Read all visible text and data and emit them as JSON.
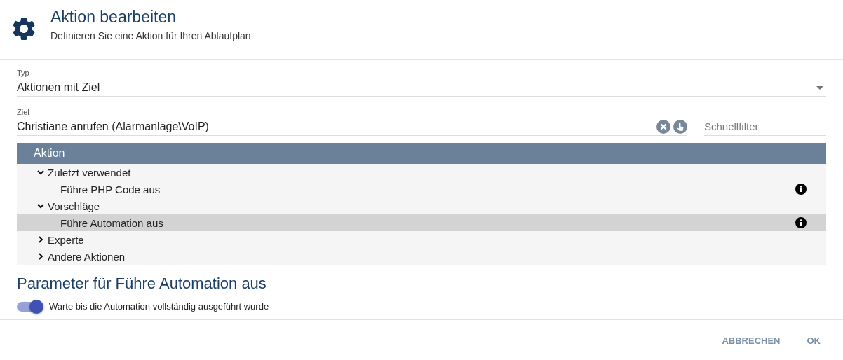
{
  "header": {
    "title": "Aktion bearbeiten",
    "subtitle": "Definieren Sie eine Aktion für Ihren Ablaufplan"
  },
  "type_field": {
    "label": "Typ",
    "value": "Aktionen mit Ziel"
  },
  "target_field": {
    "label": "Ziel",
    "value": "Christiane anrufen (Alarmanlage\\VoIP)"
  },
  "quick_filter": {
    "placeholder": "Schnellfilter"
  },
  "table": {
    "column": "Aktion",
    "tree": [
      {
        "label": "Zuletzt verwendet",
        "expanded": true,
        "children": [
          {
            "label": "Führe PHP Code aus",
            "selected": false
          }
        ]
      },
      {
        "label": "Vorschläge",
        "expanded": true,
        "children": [
          {
            "label": "Führe Automation aus",
            "selected": true
          }
        ]
      },
      {
        "label": "Experte",
        "expanded": false
      },
      {
        "label": "Andere Aktionen",
        "expanded": false
      }
    ]
  },
  "parameters": {
    "title": "Parameter für Führe Automation aus",
    "toggle": {
      "label": "Warte bis die Automation vollständig ausgeführt wurde",
      "on": true
    }
  },
  "buttons": [
    "ABBRECHEN",
    "OK"
  ]
}
